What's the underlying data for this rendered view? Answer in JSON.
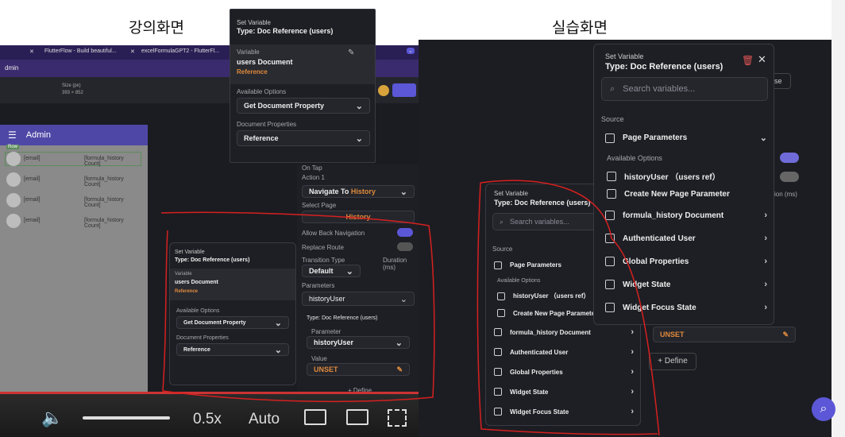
{
  "headers": {
    "left": "강의화면",
    "right": "실습화면"
  },
  "browser": {
    "tabs": [
      "FlutterFlow - Build beautiful...",
      "excelFormulaGPT2 - FlutterFl..."
    ],
    "addr": "dmin",
    "size_label": "Size (px)",
    "size_value": "393 × 852"
  },
  "phone": {
    "title": "Admin",
    "badge": "Row",
    "rows": [
      {
        "email": "[email]",
        "count": "[formula_history Count]"
      },
      {
        "email": "[email]",
        "count": "[formula_history Count]"
      },
      {
        "email": "[email]",
        "count": "[formula_history Count]"
      },
      {
        "email": "[email]",
        "count": "[formula_history Count]"
      }
    ]
  },
  "setvar_top": {
    "title": "Set Variable",
    "type": "Type: Doc Reference (users)",
    "variable_label": "Variable",
    "variable_name": "users Document",
    "reference": "Reference",
    "available_label": "Available Options",
    "available_value": "Get Document Property",
    "docprops_label": "Document Properties",
    "docprops_value": "Reference"
  },
  "setvar_mid": {
    "title": "Set Variable",
    "type": "Type: Doc Reference (users)",
    "variable_label": "Variable",
    "variable_name": "users Document",
    "reference": "Reference",
    "available_label": "Available Options",
    "available_value": "Get Document Property",
    "docprops_label": "Document Properties",
    "docprops_value": "Reference"
  },
  "action": {
    "on_tap": "On Tap",
    "action1": "Action 1",
    "navigate": "Navigate To",
    "navigate_target": "History",
    "select_page": "Select Page",
    "page": "History",
    "allow_back": "Allow Back Navigation",
    "replace": "Replace Route",
    "transition_label": "Transition Type",
    "transition": "Default",
    "duration": "Duration (ms)",
    "params": "Parameters",
    "param_name": "historyUser",
    "type_ref": "Type: Doc Reference (users)",
    "param_label": "Parameter",
    "param_value": "historyUser",
    "value_label": "Value",
    "unset": "UNSET",
    "define": "+ Define"
  },
  "video": {
    "speed": "0.5x",
    "quality": "Auto"
  },
  "picker_small": {
    "title": "Set Variable",
    "type": "Type: Doc Reference (users)",
    "search": "Search variables...",
    "source": "Source",
    "items": [
      "Page Parameters",
      "Available Options",
      "historyUser （users ref）",
      "Create New Page Parameter",
      "formula_history Document",
      "Authenticated User",
      "Global Properties",
      "Widget State",
      "Widget Focus State"
    ]
  },
  "picker_big": {
    "title": "Set Variable",
    "type": "Type: Doc Reference (users)",
    "search": "Search variables...",
    "source": "Source",
    "items": [
      "Page Parameters",
      "Available Options",
      "historyUser （users ref）",
      "Create New Page Parameter",
      "formula_history Document",
      "Authenticated User",
      "Global Properties",
      "Widget State",
      "Widget Focus State"
    ]
  },
  "right_bg": {
    "close": "Close",
    "unset": "UNSET",
    "define": "Define",
    "duration": "ion (ms)"
  }
}
